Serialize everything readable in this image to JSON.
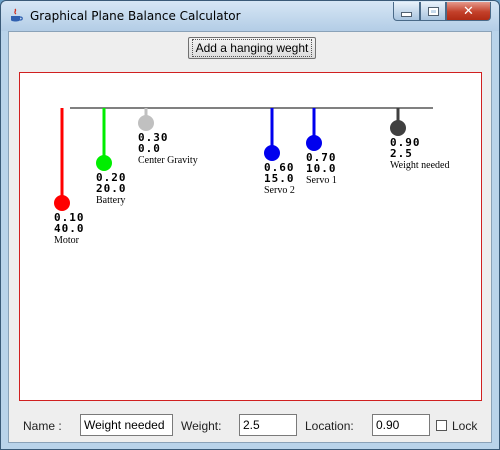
{
  "window": {
    "title": "Graphical Plane Balance Calculator"
  },
  "toolbar": {
    "add_label": "Add a hanging weght"
  },
  "balance": {
    "axis": {
      "min": 0.0,
      "max": 1.0
    },
    "items": [
      {
        "name": "Motor",
        "location": "0.10",
        "weight": "40.0",
        "color": "#ff0000"
      },
      {
        "name": "Battery",
        "location": "0.20",
        "weight": "20.0",
        "color": "#00ee00"
      },
      {
        "name": "Center Gravity",
        "location": "0.30",
        "weight": "0.0",
        "color": "#c0c0c0"
      },
      {
        "name": "Servo 2",
        "location": "0.60",
        "weight": "15.0",
        "color": "#0000ee"
      },
      {
        "name": "Servo 1",
        "location": "0.70",
        "weight": "10.0",
        "color": "#0000ee"
      },
      {
        "name": "Weight needed",
        "location": "0.90",
        "weight": "2.5",
        "color": "#404040"
      }
    ]
  },
  "form": {
    "name_label": "Name :",
    "name_value": "Weight needed",
    "weight_label": "Weight:",
    "weight_value": "2.5",
    "location_label": "Location:",
    "location_value": "0.90",
    "lock_label": "Lock",
    "lock_checked": false
  }
}
